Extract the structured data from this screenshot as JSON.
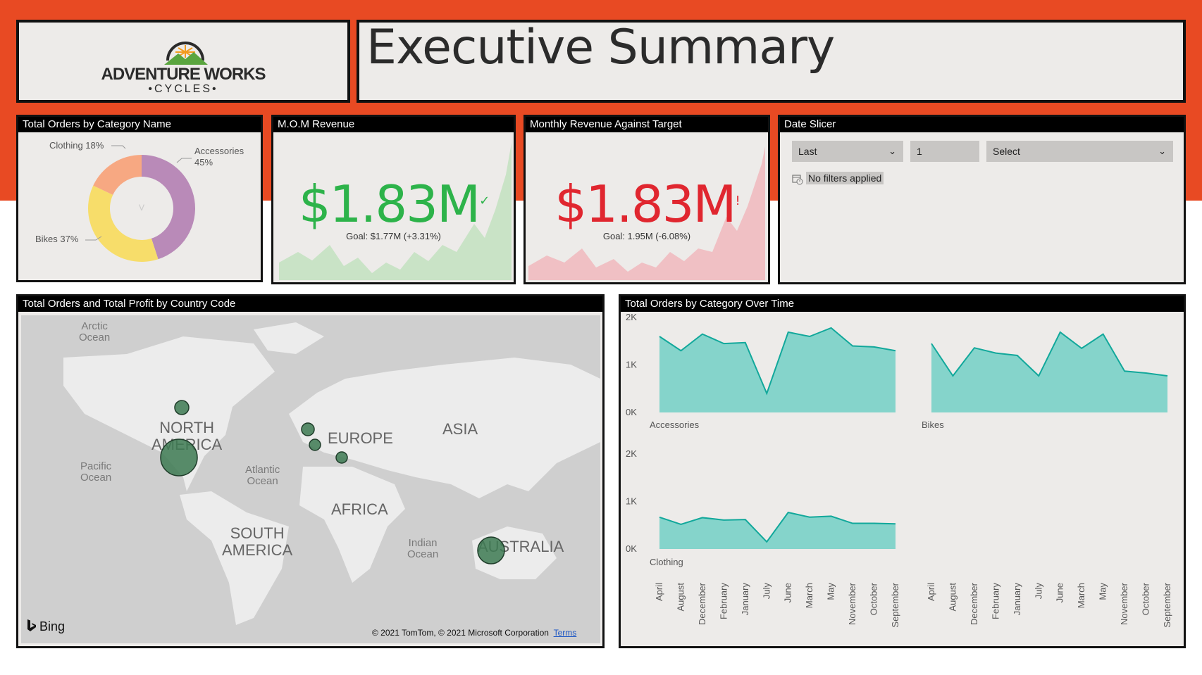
{
  "logo": {
    "line1": "ADVENTURE WORKS",
    "line2": "•CYCLES•"
  },
  "page_title": "Executive Summary",
  "donut": {
    "title": "Total Orders by Category Name",
    "center_glyph": "V",
    "labels": {
      "clothing": "Clothing 18%",
      "accessories": "Accessories",
      "accessories_pct": "45%",
      "bikes": "Bikes 37%"
    }
  },
  "mom": {
    "title": "M.O.M Revenue",
    "value": "$1.83M",
    "mark": "✓",
    "goal": "Goal: $1.77M (+3.31%)",
    "color": "#2db34a"
  },
  "target": {
    "title": "Monthly Revenue Against Target",
    "value": "$1.83M",
    "mark": "!",
    "goal": "Goal: 1.95M (-6.08%)",
    "color": "#e0262f"
  },
  "slicer": {
    "title": "Date Slicer",
    "period": "Last",
    "count": "1",
    "unit": "Select",
    "status": "No filters applied"
  },
  "map_panel": {
    "title": "Total Orders and Total Profit by Country Code",
    "continents": {
      "north_america": "NORTH\nAMERICA",
      "europe": "EUROPE",
      "asia": "ASIA",
      "africa": "AFRICA",
      "south_america": "SOUTH\nAMERICA",
      "australia": "AUSTRALIA"
    },
    "oceans": {
      "arctic": "Arctic\nOcean",
      "pacific": "Pacific\nOcean",
      "atlantic": "Atlantic\nOcean",
      "indian": "Indian\nOcean"
    },
    "brand": "Bing",
    "copyright": "© 2021 TomTom, © 2021 Microsoft Corporation",
    "terms": "Terms"
  },
  "chart_data": [
    {
      "type": "pie",
      "title": "Total Orders by Category Name",
      "categories": [
        "Accessories",
        "Bikes",
        "Clothing"
      ],
      "values": [
        45,
        37,
        18
      ],
      "unit": "%"
    },
    {
      "type": "area",
      "title": "Total Orders by Category Over Time",
      "x": [
        "April",
        "August",
        "December",
        "February",
        "January",
        "July",
        "June",
        "March",
        "May",
        "November",
        "October",
        "September"
      ],
      "y_ticks": [
        "2K",
        "1K",
        "0K"
      ],
      "ylim": [
        0,
        2000
      ],
      "series": [
        {
          "name": "Accessories",
          "values": [
            1600,
            1300,
            1650,
            1450,
            1470,
            400,
            1690,
            1600,
            1780,
            1400,
            1380,
            1300
          ]
        },
        {
          "name": "Bikes",
          "values": [
            1450,
            770,
            1360,
            1250,
            1200,
            770,
            1690,
            1350,
            1650,
            870,
            830,
            770
          ]
        },
        {
          "name": "Clothing",
          "values": [
            670,
            520,
            660,
            610,
            620,
            150,
            770,
            670,
            690,
            540,
            540,
            530
          ]
        }
      ]
    }
  ],
  "colors": {
    "band": "#e84a23",
    "teal": "#85d4cb",
    "teal_line": "#12a89b",
    "bubble": "#3d7a52"
  }
}
